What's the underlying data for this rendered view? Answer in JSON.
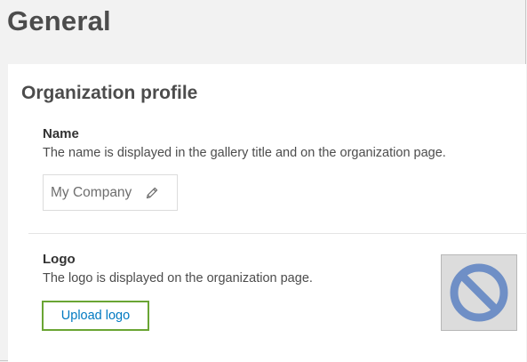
{
  "header": {
    "title": "General"
  },
  "profile": {
    "section_title": "Organization profile",
    "name": {
      "label": "Name",
      "description": "The name is displayed in the gallery title and on the organization page.",
      "value": "My Company",
      "edit_icon": "pencil-icon"
    },
    "logo": {
      "label": "Logo",
      "description": "The logo is displayed on the organization page.",
      "upload_label": "Upload logo",
      "placeholder_icon": "no-image-icon"
    }
  },
  "colors": {
    "page_background": "#f2f2f2",
    "panel_background": "#ffffff",
    "link_blue": "#0079c1",
    "highlight_green": "#6aa534",
    "placeholder_icon_blue": "#6f8fc6"
  }
}
